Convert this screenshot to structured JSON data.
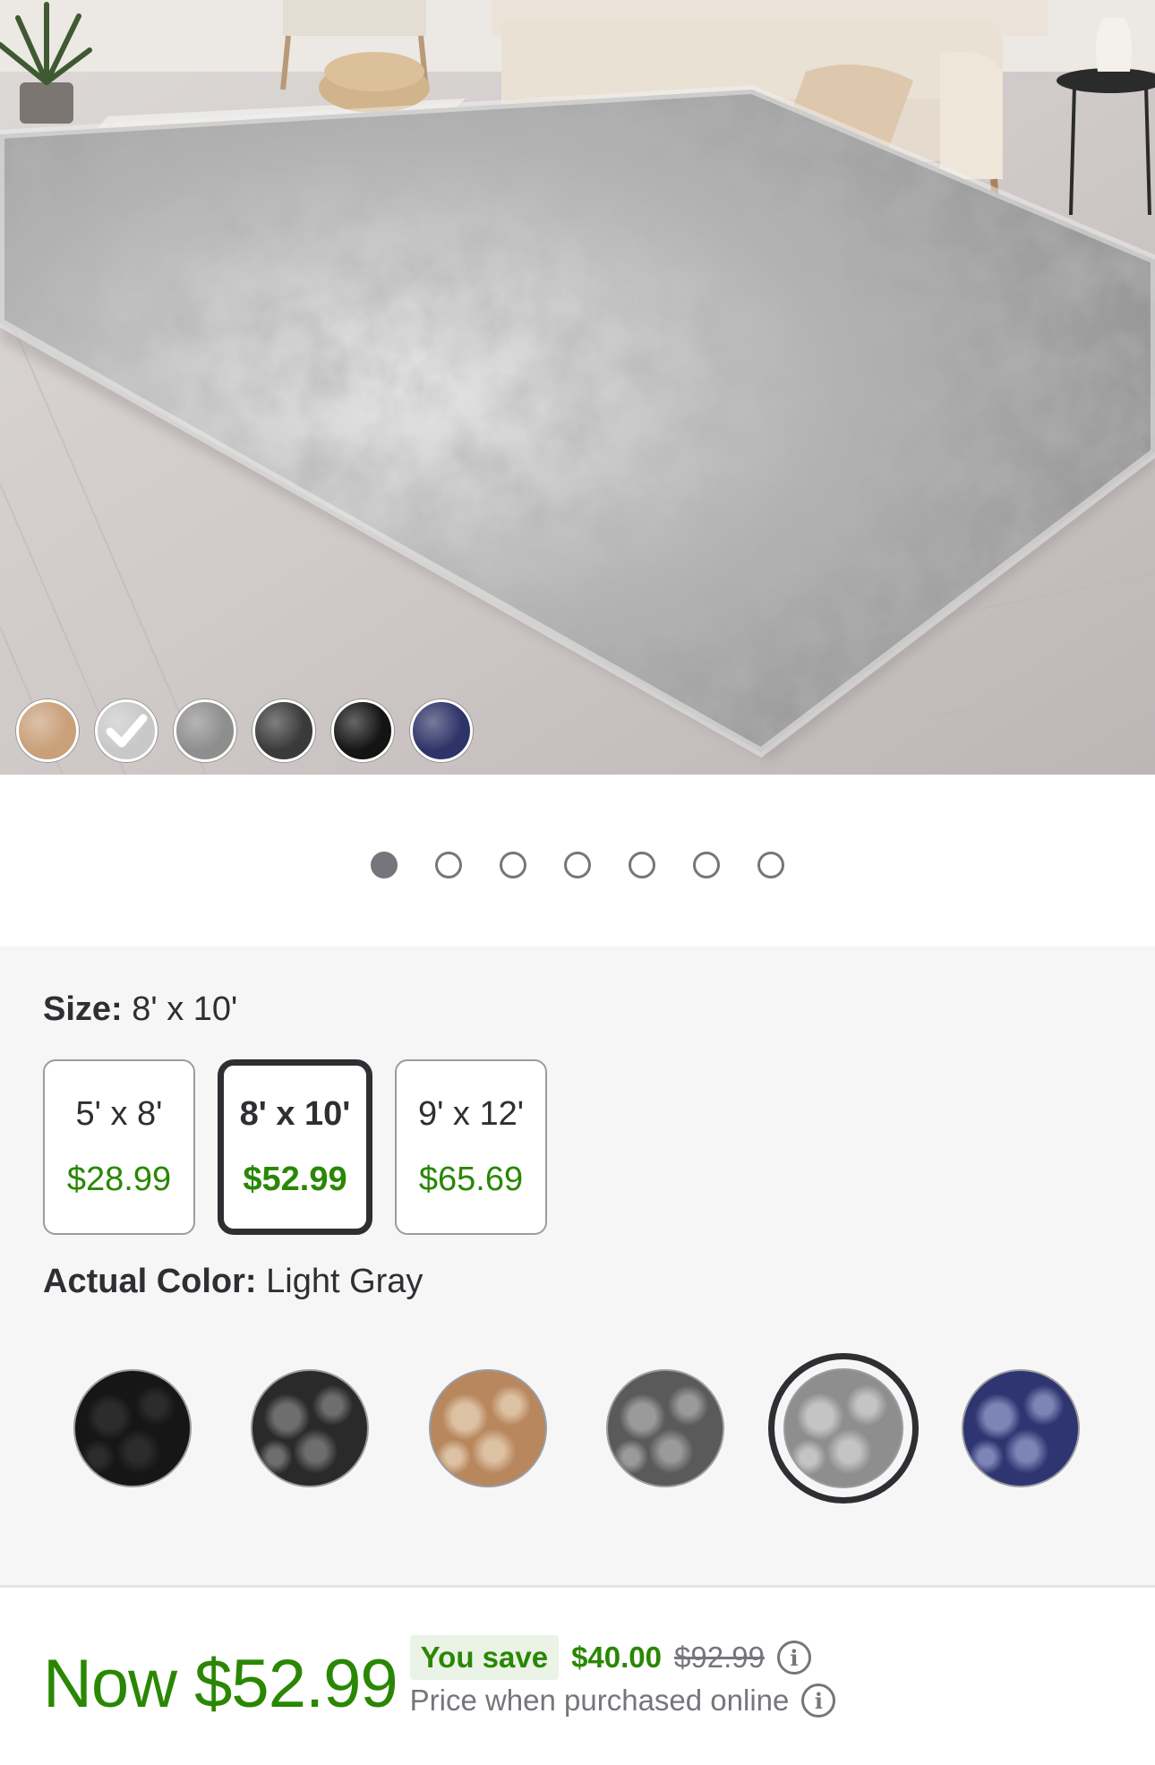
{
  "hero": {
    "color_thumbnails": [
      {
        "icon": "tan-rug-swatch",
        "color": "#c9a07a",
        "checked": false
      },
      {
        "icon": "light-gray-rug-swatch",
        "color": "#c8c8c8",
        "checked": true
      },
      {
        "icon": "gray-rug-swatch",
        "color": "#8e8e8e",
        "checked": false
      },
      {
        "icon": "charcoal-rug-swatch",
        "color": "#3a3a3a",
        "checked": false
      },
      {
        "icon": "black-rug-swatch",
        "color": "#141414",
        "checked": false
      },
      {
        "icon": "navy-rug-swatch",
        "color": "#2f3468",
        "checked": false
      }
    ]
  },
  "carousel": {
    "count": 7,
    "active_index": 0
  },
  "size": {
    "label": "Size:",
    "value": "8' x 10'",
    "options": [
      {
        "name": "5' x 8'",
        "price": "$28.99",
        "selected": false
      },
      {
        "name": "8' x 10'",
        "price": "$52.99",
        "selected": true
      },
      {
        "name": "9' x 12'",
        "price": "$65.69",
        "selected": false
      }
    ]
  },
  "color": {
    "label": "Actual Color:",
    "value": "Light Gray",
    "swatches": [
      {
        "icon": "black-swatch",
        "base": "#161616",
        "mottle": "#2c2c2c",
        "selected": false
      },
      {
        "icon": "charcoal-swatch",
        "base": "#2a2a2a",
        "mottle": "#6e6e6e",
        "selected": false
      },
      {
        "icon": "tan-swatch",
        "base": "#b8875e",
        "mottle": "#dcc1a2",
        "selected": false
      },
      {
        "icon": "dark-gray-swatch",
        "base": "#5a5a5a",
        "mottle": "#9a9a9a",
        "selected": false
      },
      {
        "icon": "light-gray-swatch",
        "base": "#8e8e8e",
        "mottle": "#c4c4c4",
        "selected": true
      },
      {
        "icon": "navy-swatch",
        "base": "#2e3570",
        "mottle": "#7d84b6",
        "selected": false
      }
    ]
  },
  "price": {
    "now": "Now $52.99",
    "you_save_label": "You save",
    "save_amount": "$40.00",
    "was_price": "$92.99",
    "note": "Price when purchased online"
  },
  "colors": {
    "accent_green": "#2a8703",
    "text_dark": "#2e2f32",
    "text_muted": "#74767c",
    "panel_bg": "#f6f6f7"
  }
}
